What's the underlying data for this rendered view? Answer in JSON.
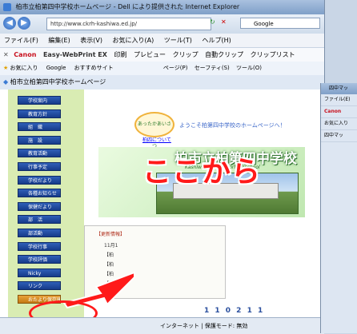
{
  "window": {
    "title": "柏市立柏第四中学校ホームページ - Dell により提供された Internet Explorer",
    "address": "http://www.ckrh-kashiwa.ed.jp/",
    "search_provider": "Google"
  },
  "menubar": [
    "ファイル(F)",
    "編集(E)",
    "表示(V)",
    "お気に入り(A)",
    "ツール(T)",
    "ヘルプ(H)"
  ],
  "toolbar1": {
    "canon": "Canon",
    "easy_webprint": "Easy-WebPrint EX",
    "print": "印刷",
    "preview": "プレビュー",
    "clip": "クリップ",
    "auto_clip": "自動クリップ",
    "clip_list": "クリップリスト"
  },
  "toolbar2": {
    "favorites": "お気に入り",
    "google": "Google",
    "recommended": "おすすめサイト"
  },
  "toolbar3": {
    "page": "ページ(P)",
    "safety": "セーフティ(S)",
    "tools": "ツール(O)"
  },
  "tab": {
    "label": "柏市立柏第四中学校ホームページ"
  },
  "page": {
    "logo_text": "あったかあいさつ",
    "welcome": "ようこそ柏第四中学校のホームページへ！",
    "about_link": "柏四について",
    "banner_title": "柏市立柏第四中学校",
    "banner_sub": "Kashiwa  No.  4  Juniorhighschool",
    "news_heading": "【更新情報】",
    "news": [
      "11月1",
      "【柏",
      "【柏",
      "【柏",
      "【柏"
    ],
    "counter": "1 1 0 2 1 1",
    "callout": "ここから"
  },
  "leftnav": [
    {
      "label": "学校案内",
      "highlight": false
    },
    {
      "label": "教育方針",
      "highlight": false
    },
    {
      "label": "組　織",
      "highlight": false
    },
    {
      "label": "施　設",
      "highlight": false
    },
    {
      "label": "教育活動",
      "highlight": false
    },
    {
      "label": "行事予定",
      "highlight": false
    },
    {
      "label": "学校だより",
      "highlight": false
    },
    {
      "label": "各種お知らせ",
      "highlight": false
    },
    {
      "label": "保健だより",
      "highlight": false
    },
    {
      "label": "部　活",
      "highlight": false
    },
    {
      "label": "部活動",
      "highlight": false
    },
    {
      "label": "学校行事",
      "highlight": false
    },
    {
      "label": "学校評価",
      "highlight": false
    },
    {
      "label": "Nicky",
      "highlight": false
    },
    {
      "label": "リンク",
      "highlight": false
    },
    {
      "label": "おたより保存庫",
      "highlight": true
    }
  ],
  "status": {
    "zone": "インターネット | 保護モード: 無効"
  },
  "window2": {
    "title": "四中マッ",
    "menu": "ファイル(E)",
    "canon": "Canon",
    "fav": "お気に入り",
    "tab": "四中マッ"
  },
  "colors": {
    "callout": "#ff1a1a",
    "nav_blue": "#1f4aa0",
    "nav_highlight": "#e8a23a",
    "sidebar_bg": "#d9ecb3"
  }
}
